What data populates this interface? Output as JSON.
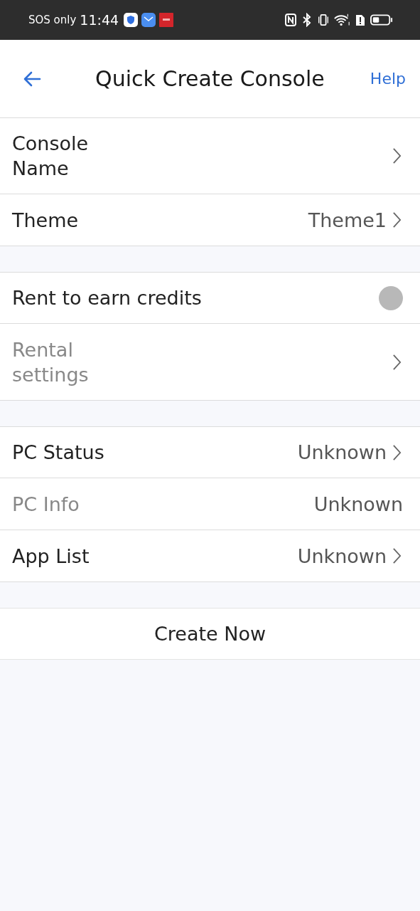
{
  "status_bar": {
    "carrier": "SOS only",
    "time": "11:44"
  },
  "header": {
    "title": "Quick Create Console",
    "action": "Help"
  },
  "sections": [
    {
      "rows": [
        {
          "kind": "nav",
          "label": "Console Name",
          "disabled": false
        },
        {
          "kind": "nav",
          "label": "Theme",
          "value": "Theme1",
          "disabled": false
        }
      ]
    },
    {
      "rows": [
        {
          "kind": "toggle",
          "label": "Rent to earn credits",
          "on": false,
          "disabled": false
        },
        {
          "kind": "nav",
          "label": "Rental settings",
          "disabled": true
        }
      ]
    },
    {
      "rows": [
        {
          "kind": "nav",
          "label": "PC Status",
          "value": "Unknown",
          "disabled": false
        },
        {
          "kind": "info",
          "label": "PC Info",
          "value": "Unknown",
          "disabled": true
        },
        {
          "kind": "nav",
          "label": "App List",
          "value": "Unknown",
          "disabled": false
        }
      ]
    }
  ],
  "primary_button": "Create Now"
}
